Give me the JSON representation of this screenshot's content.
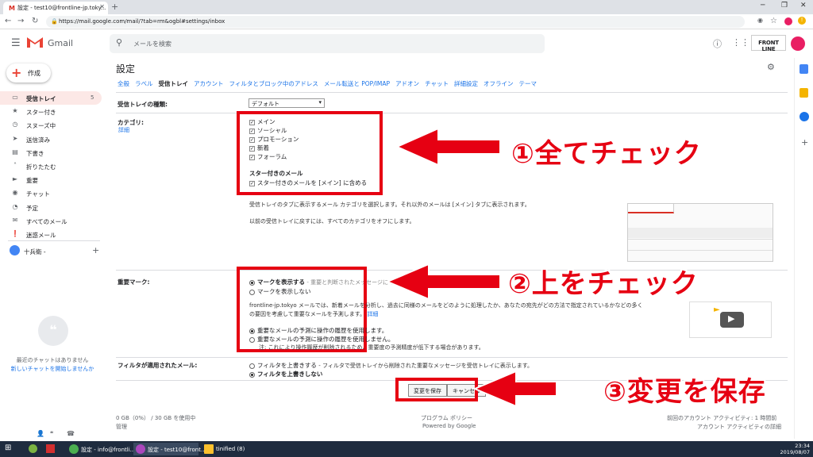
{
  "browser": {
    "tab_title": "設定 - test10@frontline-jp.toky...",
    "url": "https://mail.google.com/mail/?tab=rm&ogbl#settings/inbox"
  },
  "header": {
    "app_name": "Gmail",
    "search_placeholder": "メールを検索",
    "brand": "FRONT LINE"
  },
  "sidebar": {
    "compose_label": "作成",
    "items": [
      {
        "label": "受信トレイ",
        "count": "5",
        "icon": "inbox-icon",
        "glyph": "▭",
        "active": true
      },
      {
        "label": "スター付き",
        "count": "",
        "icon": "star-icon",
        "glyph": "★",
        "active": false
      },
      {
        "label": "スヌーズ中",
        "count": "",
        "icon": "clock-icon",
        "glyph": "◷",
        "active": false
      },
      {
        "label": "送信済み",
        "count": "",
        "icon": "send-icon",
        "glyph": "➤",
        "active": false
      },
      {
        "label": "下書き",
        "count": "",
        "icon": "draft-icon",
        "glyph": "▤",
        "active": false
      },
      {
        "label": "折りたたむ",
        "count": "",
        "icon": "chevron-up-icon",
        "glyph": "˄",
        "active": false
      },
      {
        "label": "重要",
        "count": "",
        "icon": "important-icon",
        "glyph": "►",
        "active": false
      },
      {
        "label": "チャット",
        "count": "",
        "icon": "chat-icon",
        "glyph": "◉",
        "active": false
      },
      {
        "label": "予定",
        "count": "",
        "icon": "scheduled-icon",
        "glyph": "◔",
        "active": false
      },
      {
        "label": "すべてのメール",
        "count": "",
        "icon": "all-mail-icon",
        "glyph": "✉",
        "active": false
      },
      {
        "label": "迷惑メール",
        "count": "",
        "icon": "spam-icon",
        "glyph": "❗",
        "active": false
      }
    ],
    "user_name": "十兵衛 -",
    "no_chats": "最近のチャットはありません",
    "new_chat": "新しいチャットを開始しませんか"
  },
  "settings": {
    "title": "設定",
    "tabs": [
      "全般",
      "ラベル",
      "受信トレイ",
      "アカウント",
      "フィルタとブロック中のアドレス",
      "メール転送と POP/IMAP",
      "アドオン",
      "チャット",
      "詳細設定",
      "オフライン",
      "テーマ"
    ],
    "active_tab": "受信トレイ",
    "inbox_type_label": "受信トレイの種類:",
    "inbox_type_value": "デフォルト",
    "categories_label": "カテゴリ:",
    "categories_link": "詳細",
    "categories": [
      "メイン",
      "ソーシャル",
      "プロモーション",
      "新着",
      "フォーラム"
    ],
    "starred_heading": "スター付きのメール",
    "starred_option": "スター付きのメールを [メイン] に含める",
    "categories_desc1": "受信トレイのタブに表示するメール カテゴリを選択します。それ以外のメールは [メイン] タブに表示されます。",
    "categories_desc2": "以前の受信トレイに戻すには、すべてのカテゴリをオフにします。",
    "importance_label": "重要マーク:",
    "importance_show": "マークを表示する",
    "importance_show_desc": "- 重要と判断されたメッセージにマークを表示します",
    "importance_hide": "マークを表示しない",
    "importance_desc1": "frontline-jp.tokyo メールでは、新着メールを分析し、過去に同様のメールをどのように処理したか、あなたの宛先がどの方法で指定されているかなどの多く",
    "importance_desc2": "の要因を考慮して重要なメールを予測します。",
    "importance_desc_link": "詳細",
    "predict_on": "重要なメールの予測に操作の履歴を使用します。",
    "predict_off": "重要なメールの予測に操作の履歴を使用しません。",
    "predict_note": "注: これにより操作履歴が削除されるため、重要度の予測精度が低下する場合があります。",
    "filter_label": "フィルタが適用されたメール:",
    "filter_override": "フィルタを上書きする",
    "filter_override_desc": "- フィルタで受信トレイから削除された重要なメッセージを受信トレイに表示します。",
    "filter_keep": "フィルタを上書きしない",
    "save_button": "変更を保存",
    "cancel_button": "キャンセル"
  },
  "footer": {
    "storage": "0 GB（0%） / 30 GB を使用中",
    "manage": "管理",
    "policy": "プログラム ポリシー",
    "powered": "Powered by Google",
    "activity": "前回のアカウント アクティビティ: 1 時間前",
    "activity_detail": "アカウント アクティビティの詳細"
  },
  "annotations": {
    "step1": "①全てチェック",
    "step2": "②上をチェック",
    "step3": "③変更を保存",
    "color": "#e60012"
  },
  "taskbar": {
    "items": [
      "設定 - info@frontli...",
      "設定 - test10@front...",
      "tinified (8)"
    ],
    "time": "23:34",
    "date": "2019/08/07"
  }
}
